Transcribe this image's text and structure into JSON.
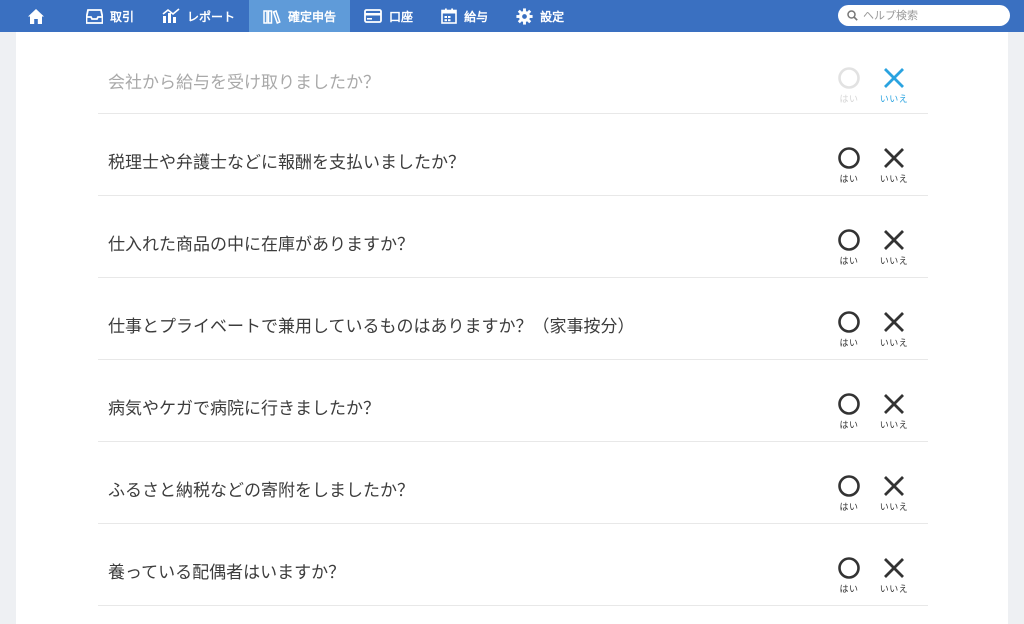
{
  "nav": {
    "home_icon": "home-icon",
    "items": [
      {
        "label": "取引",
        "icon": "inbox-icon",
        "active": false
      },
      {
        "label": "レポート",
        "icon": "bar-chart-icon",
        "active": false
      },
      {
        "label": "確定申告",
        "icon": "books-icon",
        "active": true
      },
      {
        "label": "口座",
        "icon": "card-icon",
        "active": false
      },
      {
        "label": "給与",
        "icon": "calendar-icon",
        "active": false
      },
      {
        "label": "設定",
        "icon": "gear-icon",
        "active": false
      }
    ],
    "search": {
      "placeholder": "ヘルプ検索",
      "value": ""
    }
  },
  "colors": {
    "nav_bg": "#3a70c1",
    "nav_active": "#5f9bd9",
    "selected_no": "#2aa3e0",
    "dim_text": "#a9a9a9"
  },
  "options": {
    "yes": "はい",
    "no": "いいえ"
  },
  "questions": [
    {
      "text": "会社から給与を受け取りましたか？",
      "answer": "no"
    },
    {
      "text": "税理士や弁護士などに報酬を支払いましたか？",
      "answer": null
    },
    {
      "text": "仕入れた商品の中に在庫がありますか？",
      "answer": null
    },
    {
      "text": "仕事とプライベートで兼用しているものはありますか？（家事按分）",
      "answer": null
    },
    {
      "text": "病気やケガで病院に行きましたか？",
      "answer": null
    },
    {
      "text": "ふるさと納税などの寄附をしましたか？",
      "answer": null
    },
    {
      "text": "養っている配偶者はいますか？",
      "answer": null
    }
  ]
}
